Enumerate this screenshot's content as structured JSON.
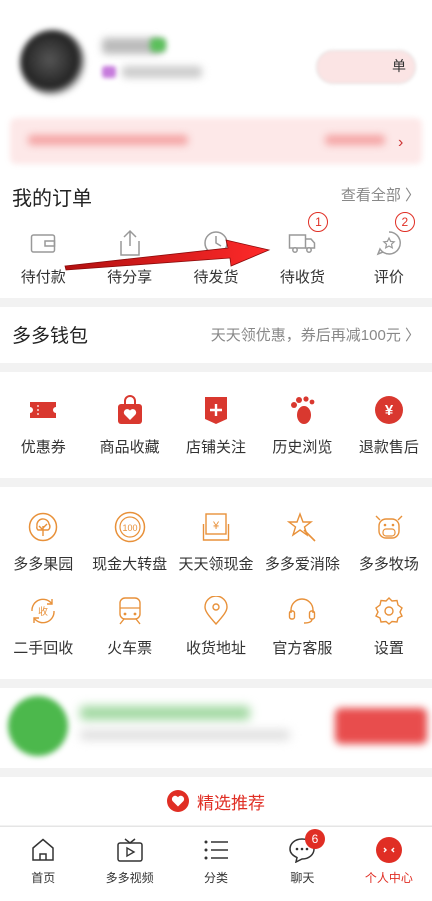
{
  "colors": {
    "accent": "#e02e24",
    "icon_orange": "#e8913a"
  },
  "profile": {
    "action_label": "单"
  },
  "orders": {
    "title": "我的订单",
    "view_all": "查看全部 〉",
    "items": [
      {
        "label": "待付款",
        "icon": "wallet-icon"
      },
      {
        "label": "待分享",
        "icon": "share-icon"
      },
      {
        "label": "待发货",
        "icon": "clock-icon"
      },
      {
        "label": "待收货",
        "icon": "truck-icon",
        "badge": "1"
      },
      {
        "label": "评价",
        "icon": "review-icon",
        "badge": "2"
      }
    ]
  },
  "wallet": {
    "title": "多多钱包",
    "promo": "天天领优惠，券后再减100元 〉"
  },
  "services": [
    {
      "label": "优惠券",
      "icon": "coupon-icon"
    },
    {
      "label": "商品收藏",
      "icon": "favorite-bag-icon"
    },
    {
      "label": "店铺关注",
      "icon": "store-follow-icon"
    },
    {
      "label": "历史浏览",
      "icon": "footprint-icon"
    },
    {
      "label": "退款售后",
      "icon": "refund-icon"
    }
  ],
  "features_row1": [
    {
      "label": "多多果园",
      "icon": "tree-icon"
    },
    {
      "label": "现金大转盘",
      "icon": "wheel-icon"
    },
    {
      "label": "天天领现金",
      "icon": "cash-envelope-icon"
    },
    {
      "label": "多多爱消除",
      "icon": "star-wand-icon"
    },
    {
      "label": "多多牧场",
      "icon": "cow-icon"
    }
  ],
  "features_row2": [
    {
      "label": "二手回收",
      "icon": "recycle-icon"
    },
    {
      "label": "火车票",
      "icon": "train-icon"
    },
    {
      "label": "收货地址",
      "icon": "location-icon"
    },
    {
      "label": "官方客服",
      "icon": "headset-icon"
    },
    {
      "label": "设置",
      "icon": "settings-icon"
    }
  ],
  "recommend": {
    "label": "精选推荐"
  },
  "tabbar": [
    {
      "label": "首页",
      "icon": "home-icon"
    },
    {
      "label": "多多视频",
      "icon": "video-icon"
    },
    {
      "label": "分类",
      "icon": "category-icon"
    },
    {
      "label": "聊天",
      "icon": "chat-icon",
      "badge": "6"
    },
    {
      "label": "个人中心",
      "icon": "profile-icon",
      "active": true
    }
  ]
}
